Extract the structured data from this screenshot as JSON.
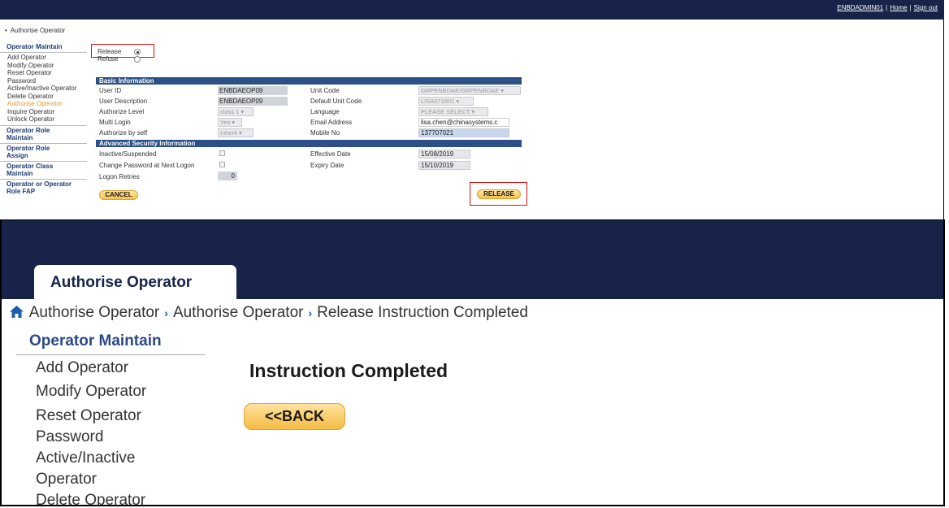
{
  "top": {
    "user": "ENBDADMIN01",
    "home": "Home",
    "signout": "Sign out",
    "breadcrumb": "Authorise Operator",
    "sidebar": {
      "group1": "Operator Maintain",
      "items": [
        "Add Operator",
        "Modify Operator",
        "Reset Operator Password",
        "Active/Inactive Operator",
        "Delete Operator",
        "Authorise Operator",
        "Inquire Operator",
        "Unlock Operator"
      ],
      "group2": "Operator Role Maintain",
      "group3": "Operator Role Assign",
      "group4": "Operator Class Maintain",
      "group5": "Operator or Operator Role FAP"
    },
    "radio": {
      "release": "Release",
      "refuse": "Refuse",
      "selected": "Release"
    },
    "basic": {
      "title": "Basic Information",
      "user_id_label": "User ID",
      "user_id": "ENBDAEOP09",
      "user_desc_label": "User Description",
      "user_desc": "ENBDAEOP09",
      "auth_level_label": "Authorize Level",
      "auth_level": "class 1",
      "multi_login_label": "Multi Login",
      "multi_login": "Yes",
      "auth_self_label": "Authorize by self",
      "auth_self": "Inherit",
      "unit_code_label": "Unit Code",
      "unit_code": "GRPENBDAE/GRPENBDAE",
      "default_unit_label": "Default Unit Code",
      "default_unit": "LISA071601",
      "language_label": "Language",
      "language": "PLEASE SELECT",
      "email_label": "Email Address",
      "email": "lisa.chen@chinasystems.c",
      "mobile_label": "Mobile No",
      "mobile": "137707021"
    },
    "advanced": {
      "title": "Advanced Security Information",
      "inactive_label": "Inactive/Suspended",
      "change_pw_label": "Change Password at Next Logon",
      "retries_label": "Logon Retries",
      "retries": "0",
      "effective_label": "Effective Date",
      "effective": "15/08/2019",
      "expiry_label": "Expiry Date",
      "expiry": "15/10/2019"
    },
    "cancel": "CANCEL",
    "release_btn": "RELEASE"
  },
  "bottom": {
    "tab": "Authorise Operator",
    "breadcrumb": [
      "Authorise Operator",
      "Authorise Operator",
      "Release Instruction Completed"
    ],
    "sidebar_group": "Operator Maintain",
    "sidebar_items": [
      "Add Operator",
      "Modify Operator",
      "Reset Operator Password",
      "Active/Inactive Operator",
      "Delete Operator"
    ],
    "title": "Instruction Completed",
    "back": "<<BACK"
  },
  "colors": {
    "navy": "#172348",
    "section": "#2b4f86",
    "accent": "#f09a1e",
    "button": "#f6c24a",
    "highlight_border": "#dd1111"
  }
}
